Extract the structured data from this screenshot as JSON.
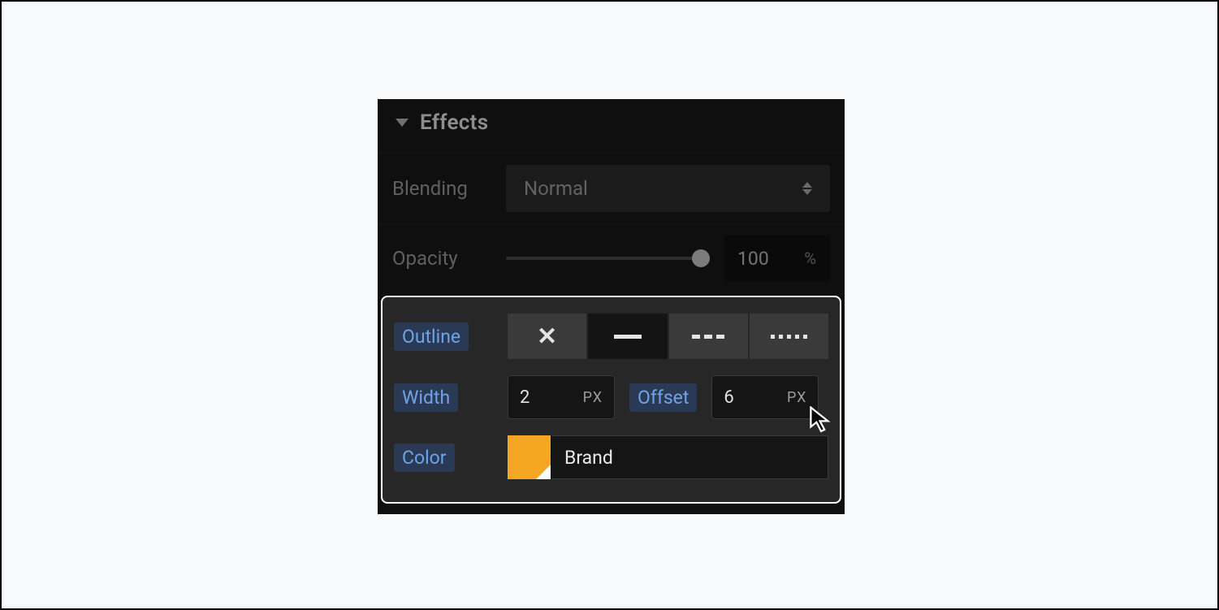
{
  "panel": {
    "title": "Effects",
    "blending": {
      "label": "Blending",
      "value": "Normal"
    },
    "opacity": {
      "label": "Opacity",
      "value": "100",
      "unit": "%"
    },
    "outline": {
      "label": "Outline",
      "styles": {
        "none": "none",
        "solid": "solid",
        "dashed": "dashed",
        "dotted": "dotted"
      },
      "selected": "solid"
    },
    "width": {
      "label": "Width",
      "value": "2",
      "unit": "PX"
    },
    "offset": {
      "label": "Offset",
      "value": "6",
      "unit": "PX"
    },
    "color": {
      "label": "Color",
      "name": "Brand",
      "hex": "#f5a623"
    }
  }
}
